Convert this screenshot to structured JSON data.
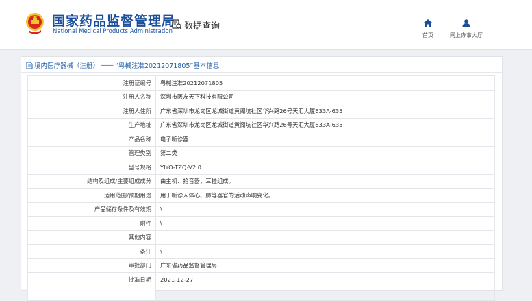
{
  "header": {
    "title_cn": "国家药品监督管理局",
    "title_en": "National Medical Products Administration",
    "section_title": "数据查询",
    "nav": [
      {
        "label": "首页",
        "icon": "home-icon"
      },
      {
        "label": "网上办事大厅",
        "icon": "user-icon"
      }
    ]
  },
  "breadcrumb": {
    "category": "境内医疗器械（注册）",
    "separator": "——",
    "record": "“粤械注准20212071805”基本信息"
  },
  "rows": [
    {
      "label": "注册证编号",
      "value": "粤械注准20212071805"
    },
    {
      "label": "注册人名称",
      "value": "深圳市医友天下科技有限公司"
    },
    {
      "label": "注册人住所",
      "value": "广东省深圳市龙岗区龙城街道黄阁坑社区华兴路26号天汇大厦633A-635"
    },
    {
      "label": "生产地址",
      "value": "广东省深圳市龙岗区龙城街道黄阁坑社区华兴路26号天汇大厦633A-635"
    },
    {
      "label": "产品名称",
      "value": "电子听诊器"
    },
    {
      "label": "管理类别",
      "value": "第二类"
    },
    {
      "label": "型号规格",
      "value": "YIYO-TZQ-V2.0"
    },
    {
      "label": "结构及组成/主要组成成分",
      "value": "由主机、拾音器、耳挂组成。"
    },
    {
      "label": "适用范围/预期用途",
      "value": "用于听诊人体心、肺等器官的活动声响变化。"
    },
    {
      "label": "产品储存条件及有效期",
      "value": "\\"
    },
    {
      "label": "附件",
      "value": "\\"
    },
    {
      "label": "其他内容",
      "value": ""
    },
    {
      "label": "备注",
      "value": "\\"
    },
    {
      "label": "审批部门",
      "value": "广东省药品监督管理局"
    },
    {
      "label": "批准日期",
      "value": "2021-12-27"
    },
    {
      "label": "",
      "value": ""
    }
  ],
  "colors": {
    "brand_blue": "#1b4f9c",
    "link_blue": "#1f5fa8",
    "emblem_red": "#d7261e",
    "emblem_gold": "#f2c230"
  }
}
